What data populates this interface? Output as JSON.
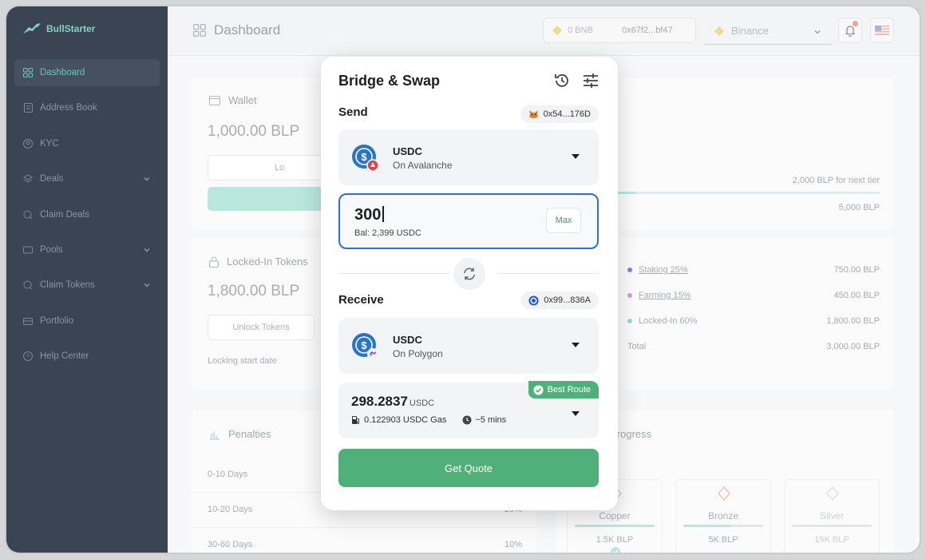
{
  "brand": {
    "name": "BullStarter"
  },
  "sidebar": {
    "items": [
      {
        "label": "Dashboard",
        "icon": "grid-icon",
        "active": true
      },
      {
        "label": "Address Book",
        "icon": "book-icon"
      },
      {
        "label": "KYC",
        "icon": "user-icon"
      },
      {
        "label": "Deals",
        "icon": "layers-icon",
        "expandable": true
      },
      {
        "label": "Claim Deals",
        "icon": "claim-icon"
      },
      {
        "label": "Pools",
        "icon": "pool-icon",
        "expandable": true
      },
      {
        "label": "Claim Tokens",
        "icon": "claim-icon",
        "expandable": true
      },
      {
        "label": "Portfolio",
        "icon": "portfolio-icon"
      },
      {
        "label": "Help Center",
        "icon": "help-icon"
      }
    ]
  },
  "header": {
    "title": "Dashboard",
    "bnb_balance": "0 BNB",
    "wallet_address": "0x67f2...bf47",
    "network": "Binance"
  },
  "wallet_card": {
    "title": "Wallet",
    "amount": "1,000.00 BLP",
    "button_partial": "Lo"
  },
  "tier_card": {
    "next_tier": "2,000 BLP for next tier",
    "target": "5,000 BLP"
  },
  "locked_card": {
    "title": "Locked-In Tokens",
    "amount": "1,800.00 BLP",
    "unlock_label": "Unlock Tokens",
    "start_date_label": "Locking start date"
  },
  "distribution": {
    "rows": [
      {
        "label": "Staking 25%",
        "value": "750.00 BLP",
        "color": "#8b7fd6"
      },
      {
        "label": "Farming 15%",
        "value": "450.00 BLP",
        "color": "#d39be0"
      },
      {
        "label": "Locked-In 60%",
        "value": "1,800.00 BLP",
        "color": "#9fd9c9"
      }
    ],
    "total_label": "Total",
    "total_value": "3,000.00 BLP"
  },
  "penalties": {
    "title": "Penalties",
    "rows": [
      {
        "range": "0-10 Days",
        "value": ""
      },
      {
        "range": "10-20 Days",
        "value": "25%"
      },
      {
        "range": "30-60 Days",
        "value": "10%"
      }
    ]
  },
  "progress": {
    "title": "Progress",
    "tiers": [
      {
        "name": "Copper",
        "amount": "1.5K BLP",
        "fill": 1.0
      },
      {
        "name": "Bronze",
        "amount": "5K BLP",
        "fill": 0.6
      },
      {
        "name": "Silver",
        "amount": "15K BLP",
        "fill": 0
      }
    ]
  },
  "modal": {
    "title": "Bridge & Swap",
    "send": {
      "label": "Send",
      "address": "0x54...176D",
      "token": "USDC",
      "chain": "On Avalanche",
      "amount": "300",
      "balance": "Bal: 2,399 USDC",
      "max_label": "Max"
    },
    "receive": {
      "label": "Receive",
      "address": "0x99...836A",
      "token": "USDC",
      "chain": "On Polygon"
    },
    "route": {
      "badge": "Best Route",
      "amount": "298.2837",
      "unit": "USDC",
      "gas": "0.122903 USDC Gas",
      "time": "~5 mins"
    },
    "quote_button": "Get Quote"
  }
}
